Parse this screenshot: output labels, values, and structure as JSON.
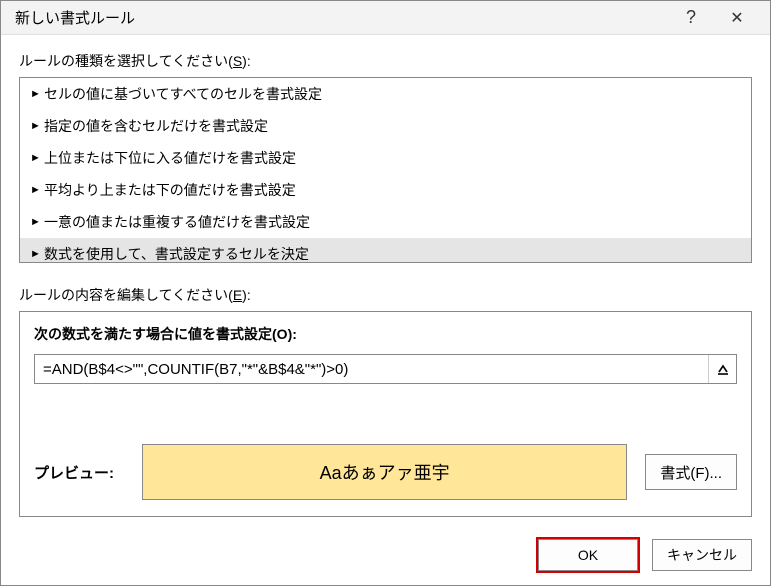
{
  "titlebar": {
    "title": "新しい書式ルール",
    "help": "?",
    "close": "✕"
  },
  "ruleType": {
    "label_prefix": "ルールの種類を選択してください(",
    "label_key": "S",
    "label_suffix": "):",
    "items": [
      "セルの値に基づいてすべてのセルを書式設定",
      "指定の値を含むセルだけを書式設定",
      "上位または下位に入る値だけを書式設定",
      "平均より上または下の値だけを書式設定",
      "一意の値または重複する値だけを書式設定",
      "数式を使用して、書式設定するセルを決定"
    ],
    "selectedIndex": 5
  },
  "ruleEdit": {
    "label_prefix": "ルールの内容を編集してください(",
    "label_key": "E",
    "label_suffix": "):",
    "formula_label_prefix": "次の数式を満たす場合に値を書式設定(",
    "formula_label_key": "O",
    "formula_label_suffix": "):",
    "formula_value": "=AND(B$4<>\"\",COUNTIF(B7,\"*\"&B$4&\"*\")>0)",
    "preview_label": "プレビュー:",
    "preview_sample": "Aaあぁアァ亜宇",
    "format_btn_prefix": "書式(",
    "format_btn_key": "F",
    "format_btn_suffix": ")..."
  },
  "buttons": {
    "ok": "OK",
    "cancel": "キャンセル"
  }
}
